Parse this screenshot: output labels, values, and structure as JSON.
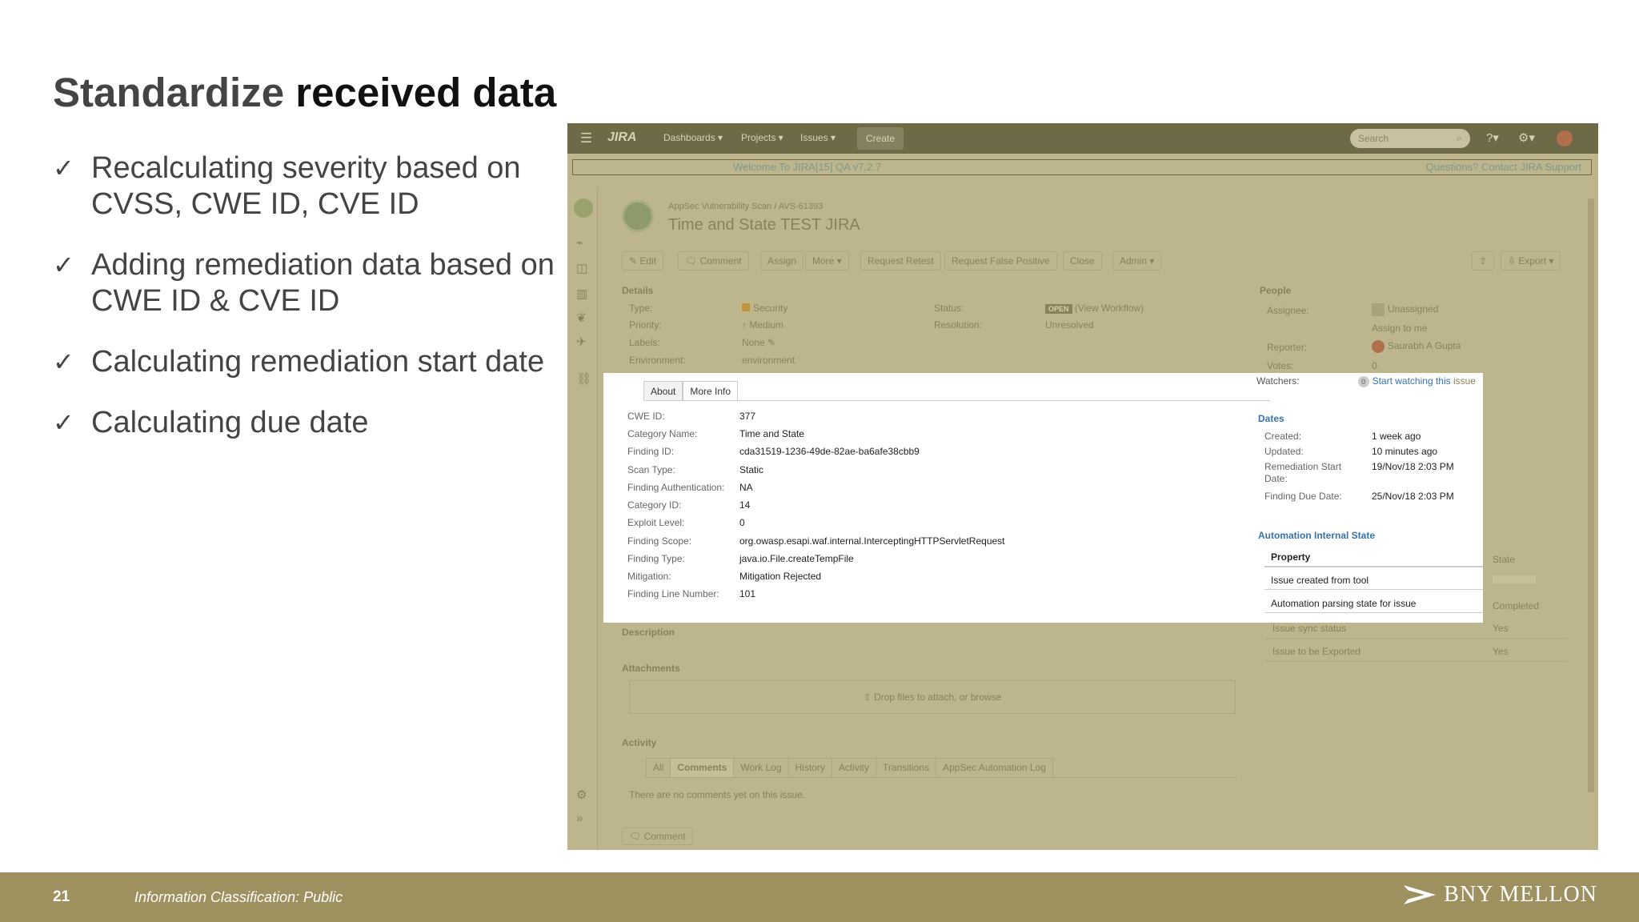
{
  "slide": {
    "title_part1": "Standardize",
    "title_part2": "received data",
    "bullets": [
      "Recalculating severity based on CVSS, CWE ID, CVE ID",
      "Adding remediation data based on CWE ID & CVE ID",
      "Calculating remediation start date",
      "Calculating due date"
    ],
    "check_glyph": "✓",
    "page_number": "21",
    "classification": "Information Classification: Public",
    "brand": "BNY MELLON",
    "footer_color": "#9e9160"
  },
  "jira": {
    "topbar": {
      "logo": "JIRA",
      "nav": [
        "Dashboards ▾",
        "Projects ▾",
        "Issues ▾"
      ],
      "create": "Create",
      "search_placeholder": "Search",
      "help": "?▾",
      "settings": "⚙▾"
    },
    "welcome_left": "Welcome To JIRA[15] QA v7.2.7",
    "welcome_right": "Questions? Contact JIRA Support",
    "breadcrumb": "AppSec Vulnerability Scan / AVS-61393",
    "issue_title": "Time and State TEST JIRA",
    "toolbar": [
      "✎ Edit",
      "🗨 Comment",
      "Assign",
      "More ▾",
      "Request Retest",
      "Request False Positive",
      "Close",
      "Admin ▾"
    ],
    "toolbar_right": [
      "⇪",
      "⇩ Export ▾"
    ],
    "details": {
      "header": "Details",
      "type_label": "Type:",
      "type_value": "Security",
      "priority_label": "Priority:",
      "priority_value": "Medium",
      "labels_label": "Labels:",
      "labels_value": "None",
      "env_label": "Environment:",
      "env_value": "environment",
      "status_label": "Status:",
      "status_badge": "OPEN",
      "status_link": "(View Workflow)",
      "resolution_label": "Resolution:",
      "resolution_value": "Unresolved"
    },
    "people": {
      "header": "People",
      "assignee_label": "Assignee:",
      "assignee_value": "Unassigned",
      "assign_me": "Assign to me",
      "reporter_label": "Reporter:",
      "reporter_value": "Saurabh A Gupta",
      "votes_label": "Votes:",
      "votes_value": "0",
      "watchers_label": "Watchers:",
      "watchers_count": "0",
      "watch_link": "Start watching this",
      "watch_suffix": "issue"
    },
    "tabs": [
      "About",
      "More Info"
    ],
    "fields": [
      {
        "label": "CWE ID:",
        "value": "377"
      },
      {
        "label": "Category Name:",
        "value": "Time and State"
      },
      {
        "label": "Finding ID:",
        "value": "cda31519-1236-49de-82ae-ba6afe38cbb9"
      },
      {
        "label": "Scan Type:",
        "value": "Static"
      },
      {
        "label": "Finding Authentication:",
        "value": "NA"
      },
      {
        "label": "Category ID:",
        "value": "14"
      },
      {
        "label": "Exploit Level:",
        "value": "0"
      },
      {
        "label": "Finding Scope:",
        "value": "org.owasp.esapi.waf.internal.InterceptingHTTPServletRequest"
      },
      {
        "label": "Finding Type:",
        "value": "java.io.File.createTempFile"
      },
      {
        "label": "Mitigation:",
        "value": "Mitigation Rejected"
      },
      {
        "label": "Finding Line Number:",
        "value": "101"
      }
    ],
    "dates": {
      "header": "Dates",
      "created_label": "Created:",
      "created": "1 week ago",
      "updated_label": "Updated:",
      "updated": "10 minutes ago",
      "rem_label": "Remediation Start Date:",
      "rem": "19/Nov/18 2:03 PM",
      "due_label": "Finding Due Date:",
      "due": "25/Nov/18 2:03 PM"
    },
    "automation": {
      "header": "Automation Internal State",
      "col_property": "Property",
      "col_state": "State",
      "rows": [
        {
          "property": "Issue created from tool",
          "state": ""
        },
        {
          "property": "Automation parsing state for issue",
          "state": "Completed"
        },
        {
          "property": "Issue sync status",
          "state": "Yes"
        },
        {
          "property": "Issue to be Exported",
          "state": "Yes"
        }
      ]
    },
    "description_header": "Description",
    "attachments_header": "Attachments",
    "drop_text": "Drop files to attach, or browse",
    "activity_header": "Activity",
    "activity_tabs": [
      "All",
      "Comments",
      "Work Log",
      "History",
      "Activity",
      "Transitions",
      "AppSec Automation Log"
    ],
    "no_comments": "There are no comments yet on this issue.",
    "comment_button": "Comment"
  }
}
